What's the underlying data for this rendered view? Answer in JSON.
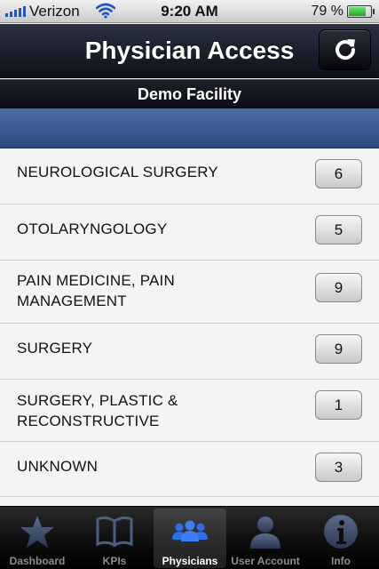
{
  "status_bar": {
    "carrier": "Verizon",
    "time": "9:20 AM",
    "battery_percent": "79 %",
    "battery_level": 0.79
  },
  "nav": {
    "title": "Physician Access",
    "refresh_icon": "refresh-icon"
  },
  "facility": {
    "name": "Demo Facility"
  },
  "specialties": [
    {
      "label": "NEUROLOGICAL SURGERY",
      "count": "6"
    },
    {
      "label": "OTOLARYNGOLOGY",
      "count": "5"
    },
    {
      "label": "PAIN MEDICINE, PAIN MANAGEMENT",
      "count": "9"
    },
    {
      "label": "SURGERY",
      "count": "9"
    },
    {
      "label": "SURGERY, PLASTIC & RECONSTRUCTIVE",
      "count": "1"
    },
    {
      "label": "UNKNOWN",
      "count": "3"
    }
  ],
  "tabs": [
    {
      "label": "Dashboard",
      "icon": "star-icon"
    },
    {
      "label": "KPIs",
      "icon": "book-icon"
    },
    {
      "label": "Physicians",
      "icon": "people-icon",
      "selected": true
    },
    {
      "label": "User Account",
      "icon": "person-icon"
    },
    {
      "label": "Info",
      "icon": "info-icon"
    }
  ],
  "colors": {
    "nav_dark": "#1b1f2b",
    "section_band": "#3d5a8f",
    "tab_selected_icon": "#2e6ee6",
    "tab_icon": "#3a4a6a"
  }
}
